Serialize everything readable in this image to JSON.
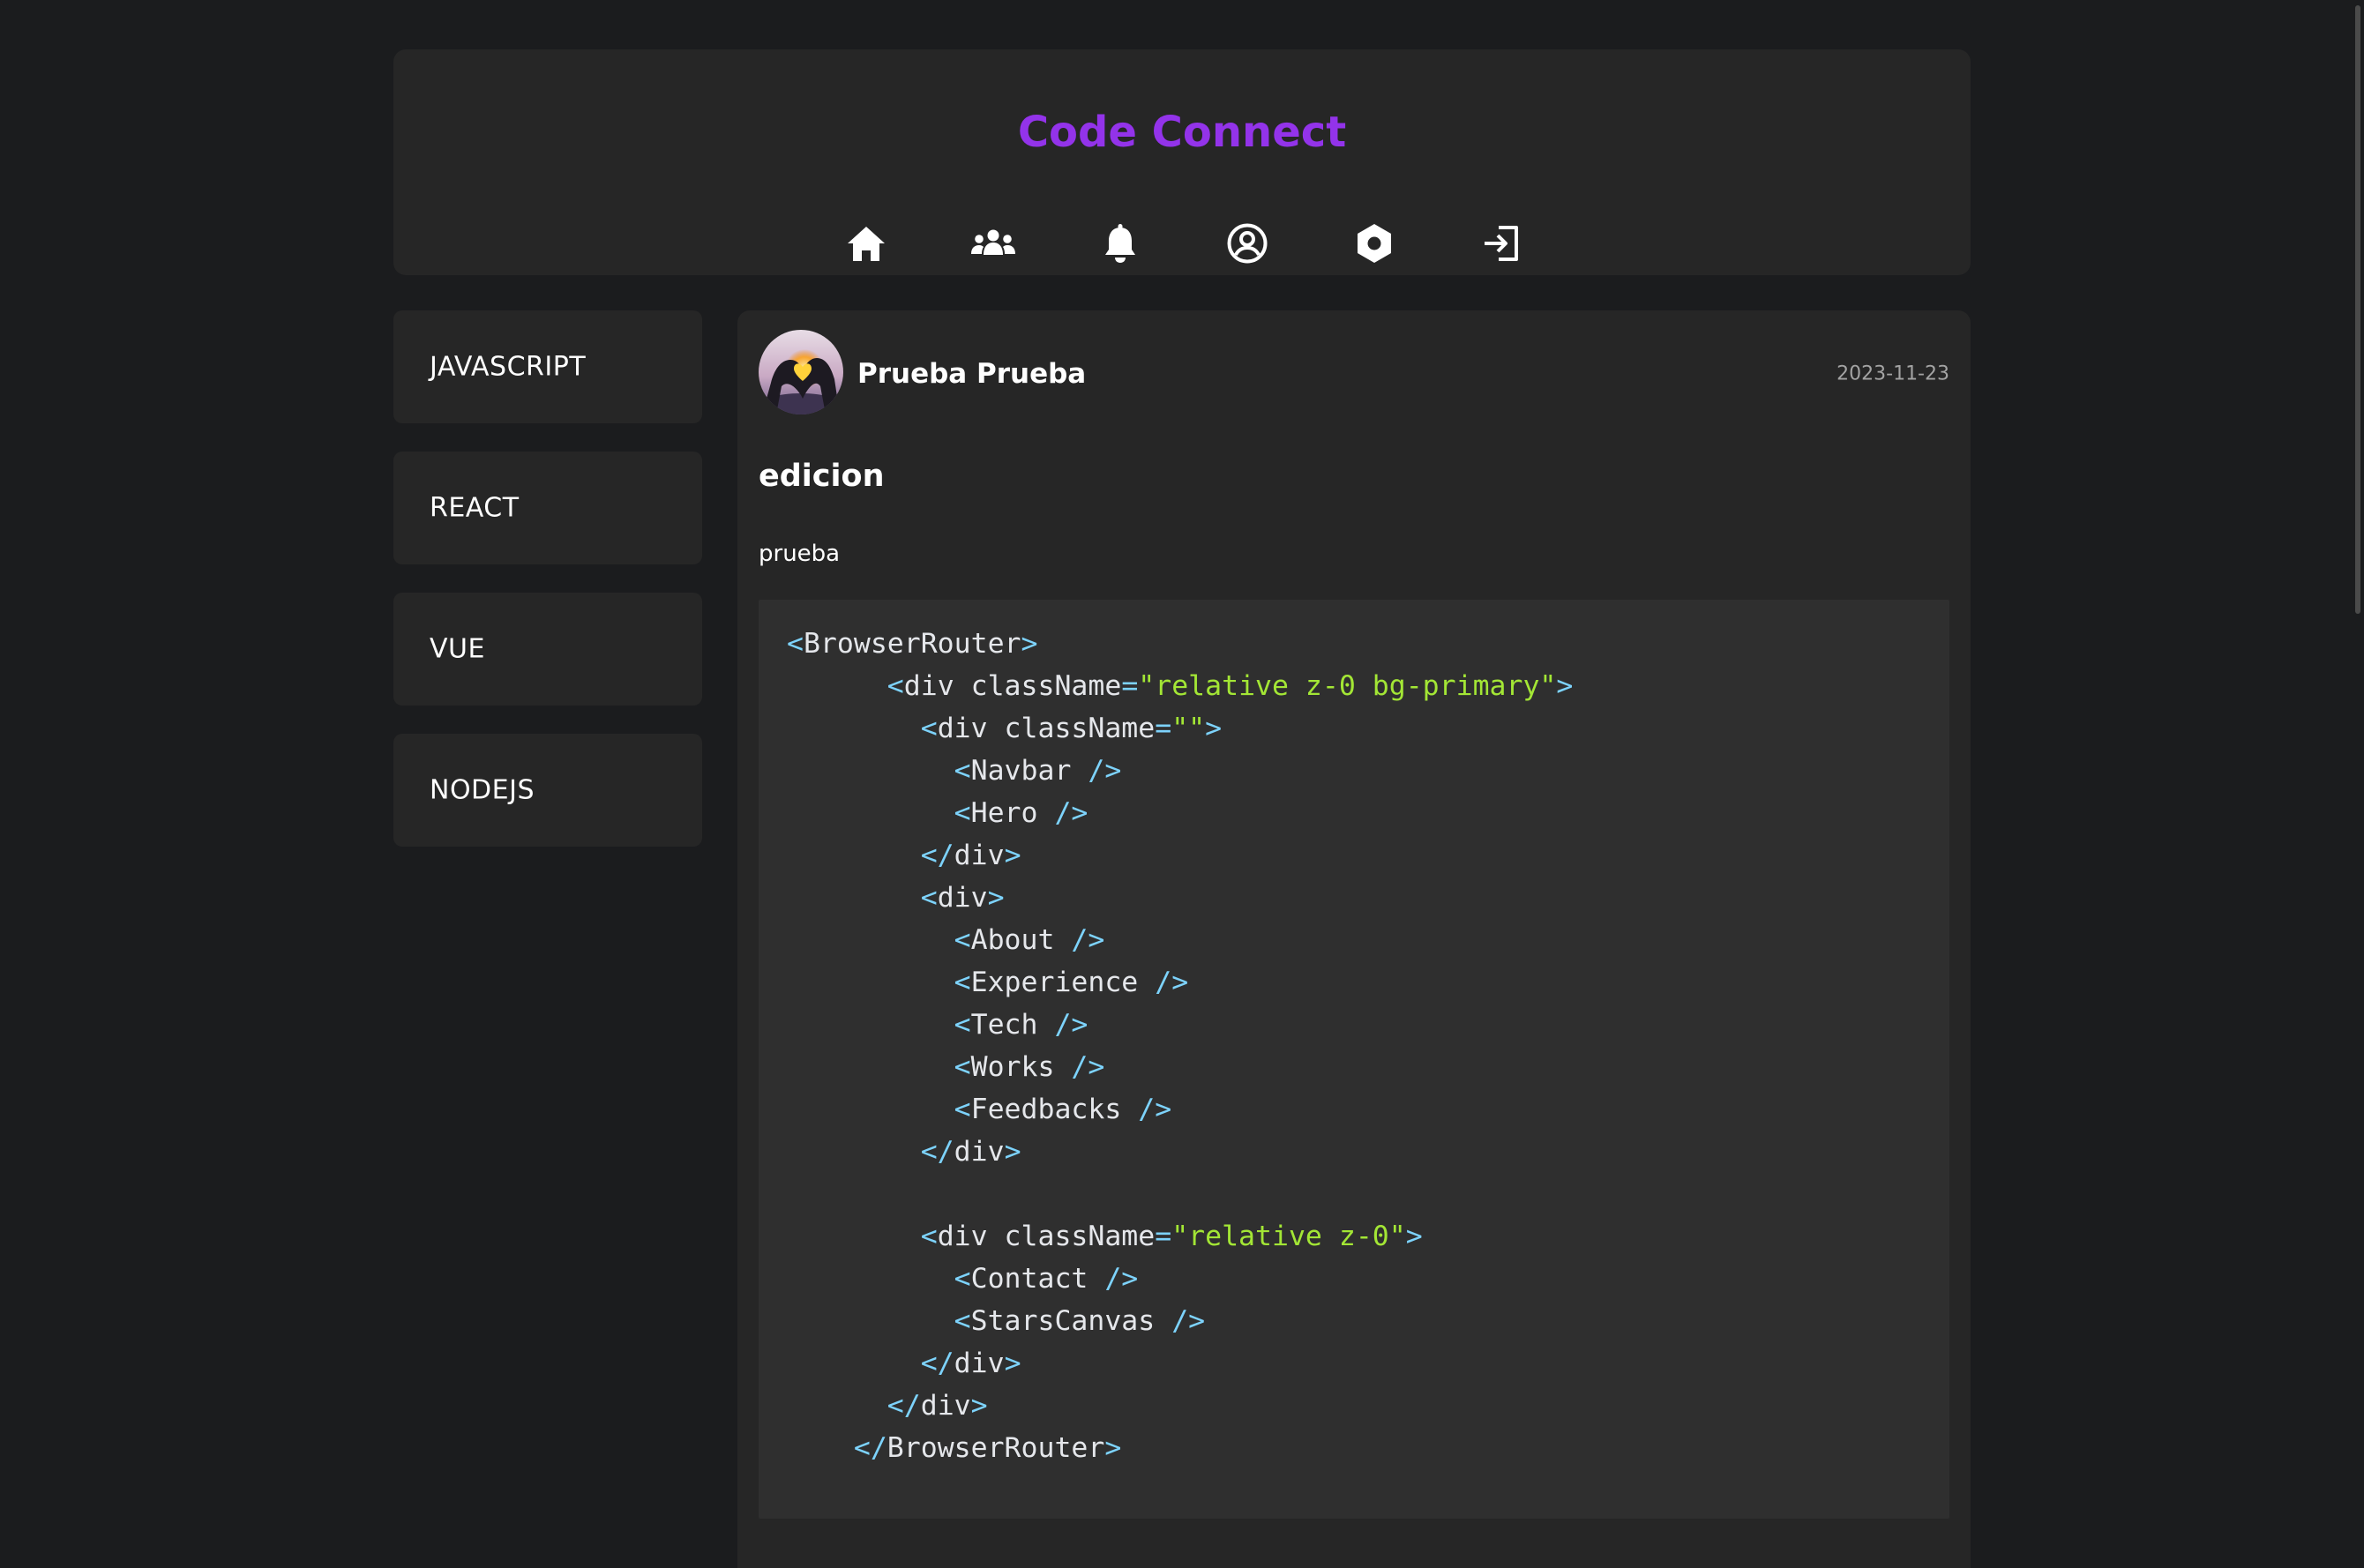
{
  "brand": {
    "title": "Code Connect"
  },
  "nav": {
    "items": [
      {
        "name": "home-icon",
        "label": "Home"
      },
      {
        "name": "community-icon",
        "label": "Community"
      },
      {
        "name": "bell-icon",
        "label": "Notifications"
      },
      {
        "name": "user-circle-icon",
        "label": "Profile"
      },
      {
        "name": "settings-icon",
        "label": "Settings"
      },
      {
        "name": "logout-icon",
        "label": "Logout"
      }
    ]
  },
  "sidebar": {
    "items": [
      {
        "label": "JAVASCRIPT"
      },
      {
        "label": "REACT"
      },
      {
        "label": "VUE"
      },
      {
        "label": "NODEJS"
      }
    ]
  },
  "post": {
    "author": "Prueba Prueba",
    "date": "2023-11-23",
    "title": "edicion",
    "description": "prueba",
    "code_lines": [
      [
        [
          "p",
          "<"
        ],
        [
          "t",
          "BrowserRouter"
        ],
        [
          "p",
          ">"
        ]
      ],
      [
        [
          "t",
          "      "
        ],
        [
          "p",
          "<"
        ],
        [
          "t",
          "div "
        ],
        [
          "a",
          "className"
        ],
        [
          "p",
          "="
        ],
        [
          "s",
          "\"relative z-0 bg-primary\""
        ],
        [
          "p",
          ">"
        ]
      ],
      [
        [
          "t",
          "        "
        ],
        [
          "p",
          "<"
        ],
        [
          "t",
          "div "
        ],
        [
          "a",
          "className"
        ],
        [
          "p",
          "="
        ],
        [
          "s",
          "\"\""
        ],
        [
          "p",
          ">"
        ]
      ],
      [
        [
          "t",
          "          "
        ],
        [
          "p",
          "<"
        ],
        [
          "t",
          "Navbar "
        ],
        [
          "p",
          "/>"
        ]
      ],
      [
        [
          "t",
          "          "
        ],
        [
          "p",
          "<"
        ],
        [
          "t",
          "Hero "
        ],
        [
          "p",
          "/>"
        ]
      ],
      [
        [
          "t",
          "        "
        ],
        [
          "p",
          "</"
        ],
        [
          "t",
          "div"
        ],
        [
          "p",
          ">"
        ]
      ],
      [
        [
          "t",
          "        "
        ],
        [
          "p",
          "<"
        ],
        [
          "t",
          "div"
        ],
        [
          "p",
          ">"
        ]
      ],
      [
        [
          "t",
          "          "
        ],
        [
          "p",
          "<"
        ],
        [
          "t",
          "About "
        ],
        [
          "p",
          "/>"
        ]
      ],
      [
        [
          "t",
          "          "
        ],
        [
          "p",
          "<"
        ],
        [
          "t",
          "Experience "
        ],
        [
          "p",
          "/>"
        ]
      ],
      [
        [
          "t",
          "          "
        ],
        [
          "p",
          "<"
        ],
        [
          "t",
          "Tech "
        ],
        [
          "p",
          "/>"
        ]
      ],
      [
        [
          "t",
          "          "
        ],
        [
          "p",
          "<"
        ],
        [
          "t",
          "Works "
        ],
        [
          "p",
          "/>"
        ]
      ],
      [
        [
          "t",
          "          "
        ],
        [
          "p",
          "<"
        ],
        [
          "t",
          "Feedbacks "
        ],
        [
          "p",
          "/>"
        ]
      ],
      [
        [
          "t",
          "        "
        ],
        [
          "p",
          "</"
        ],
        [
          "t",
          "div"
        ],
        [
          "p",
          ">"
        ]
      ],
      [],
      [
        [
          "t",
          "        "
        ],
        [
          "p",
          "<"
        ],
        [
          "t",
          "div "
        ],
        [
          "a",
          "className"
        ],
        [
          "p",
          "="
        ],
        [
          "s",
          "\"relative z-0\""
        ],
        [
          "p",
          ">"
        ]
      ],
      [
        [
          "t",
          "          "
        ],
        [
          "p",
          "<"
        ],
        [
          "t",
          "Contact "
        ],
        [
          "p",
          "/>"
        ]
      ],
      [
        [
          "t",
          "          "
        ],
        [
          "p",
          "<"
        ],
        [
          "t",
          "StarsCanvas "
        ],
        [
          "p",
          "/>"
        ]
      ],
      [
        [
          "t",
          "        "
        ],
        [
          "p",
          "</"
        ],
        [
          "t",
          "div"
        ],
        [
          "p",
          ">"
        ]
      ],
      [
        [
          "t",
          "      "
        ],
        [
          "p",
          "</"
        ],
        [
          "t",
          "div"
        ],
        [
          "p",
          ">"
        ]
      ],
      [
        [
          "t",
          "    "
        ],
        [
          "p",
          "</"
        ],
        [
          "t",
          "BrowserRouter"
        ],
        [
          "p",
          ">"
        ]
      ]
    ]
  },
  "colors": {
    "background": "#1b1c1e",
    "card": "#262626",
    "code_bg": "#2f2f2f",
    "brand": "#9333ea",
    "punct": "#7dd3fc",
    "string": "#a3e635"
  }
}
